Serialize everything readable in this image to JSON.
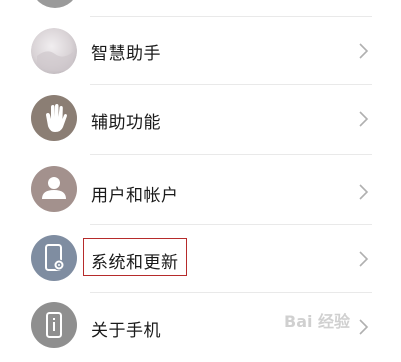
{
  "settings": {
    "items": [
      {
        "label": "智慧助手",
        "icon": "assistant-icon"
      },
      {
        "label": "辅助功能",
        "icon": "hand-icon"
      },
      {
        "label": "用户和帐户",
        "icon": "user-icon"
      },
      {
        "label": "系统和更新",
        "icon": "phone-settings-icon"
      },
      {
        "label": "关于手机",
        "icon": "info-icon"
      }
    ]
  },
  "watermark": {
    "text": "Bai 经验"
  },
  "colors": {
    "icon_bg": "#8c8c8c",
    "highlight_border": "#b62b2b",
    "chevron": "#b0b0b0"
  }
}
